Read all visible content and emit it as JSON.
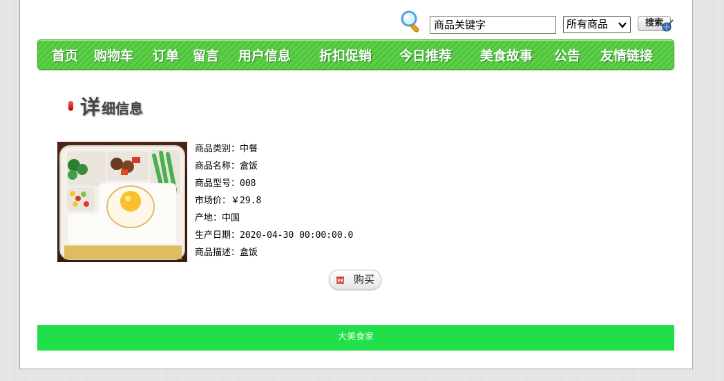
{
  "search": {
    "keyword_value": "商品关键字",
    "category_selected": "所有商品",
    "button_label": "搜索"
  },
  "nav": {
    "items": [
      "首页",
      "购物车",
      "订单",
      "留言",
      "用户信息",
      "折扣促销",
      "今日推荐",
      "美食故事",
      "公告",
      "友情链接"
    ]
  },
  "detail": {
    "heading_first_char": "详",
    "heading_rest": "细信息"
  },
  "product": {
    "image_icon": "bento-lunchbox-photo",
    "category": "商品类别：中餐",
    "name": "商品名称：盒饭",
    "model": "商品型号：008",
    "market_price": "市场价：￥29.8",
    "origin": "产地：中国",
    "production_date": "生产日期：2020-04-30 00:00:00.0",
    "description": "商品描述：盒饭"
  },
  "buy_button_label": "购买",
  "footer": {
    "text": "大美食家"
  },
  "colors": {
    "nav_green": "#5fd04a",
    "footer_green": "#21df49",
    "page_background": "#e6e6e6"
  }
}
